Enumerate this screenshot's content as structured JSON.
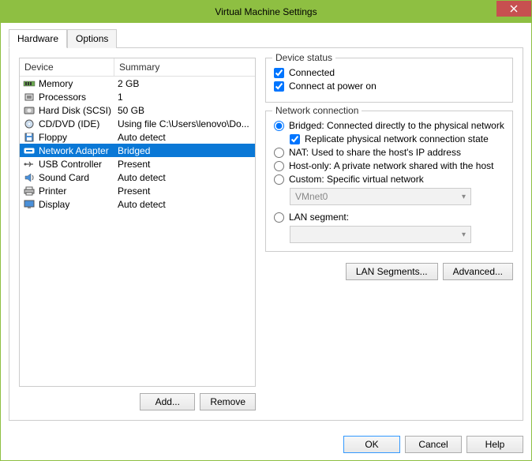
{
  "title": "Virtual Machine Settings",
  "tabs": {
    "hardware": "Hardware",
    "options": "Options"
  },
  "list": {
    "col_device": "Device",
    "col_summary": "Summary",
    "rows": [
      {
        "name": "Memory",
        "summary": "2 GB",
        "icon": "memory"
      },
      {
        "name": "Processors",
        "summary": "1",
        "icon": "cpu"
      },
      {
        "name": "Hard Disk (SCSI)",
        "summary": "50 GB",
        "icon": "disk"
      },
      {
        "name": "CD/DVD (IDE)",
        "summary": "Using file C:\\Users\\lenovo\\Do...",
        "icon": "cd"
      },
      {
        "name": "Floppy",
        "summary": "Auto detect",
        "icon": "floppy"
      },
      {
        "name": "Network Adapter",
        "summary": "Bridged",
        "icon": "net",
        "selected": true
      },
      {
        "name": "USB Controller",
        "summary": "Present",
        "icon": "usb"
      },
      {
        "name": "Sound Card",
        "summary": "Auto detect",
        "icon": "sound"
      },
      {
        "name": "Printer",
        "summary": "Present",
        "icon": "printer"
      },
      {
        "name": "Display",
        "summary": "Auto detect",
        "icon": "display"
      }
    ]
  },
  "buttons": {
    "add": "Add...",
    "remove": "Remove"
  },
  "status_group": {
    "title": "Device status",
    "connected": "Connected",
    "connect_power": "Connect at power on"
  },
  "net_group": {
    "title": "Network connection",
    "bridged": "Bridged: Connected directly to the physical network",
    "replicate": "Replicate physical network connection state",
    "nat": "NAT: Used to share the host's IP address",
    "hostonly": "Host-only: A private network shared with the host",
    "custom": "Custom: Specific virtual network",
    "custom_net": "VMnet0",
    "lanseg": "LAN segment:",
    "btn_lan": "LAN Segments...",
    "btn_adv": "Advanced..."
  },
  "footer": {
    "ok": "OK",
    "cancel": "Cancel",
    "help": "Help"
  }
}
